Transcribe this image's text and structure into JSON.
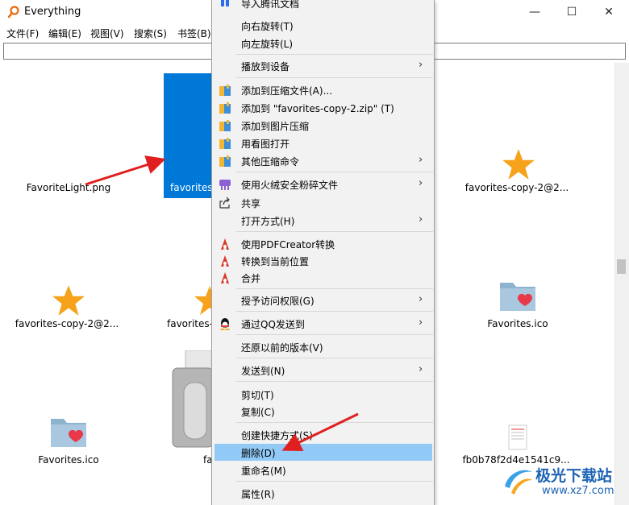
{
  "window": {
    "title": "Everything",
    "minimize": "—",
    "maximize": "☐",
    "close": "✕"
  },
  "menubar": [
    "文件(F)",
    "编辑(E)",
    "视图(V)",
    "搜索(S)",
    "书签(B)"
  ],
  "search": {
    "value": ""
  },
  "files": [
    {
      "label": "FavoriteLight.png",
      "icon": "file-icon"
    },
    {
      "label": "favorites",
      "icon": "selected-file",
      "selected": true
    },
    {
      "label": "favorites-copy-2@2...",
      "icon": "star-icon"
    },
    {
      "label": "favorites-copy-2@2...",
      "icon": "star-icon"
    },
    {
      "label": "favorites-",
      "icon": "star-icon"
    },
    {
      "label": "Favorites.ico",
      "icon": "folder-heart-icon"
    },
    {
      "label": "Favorites.ico",
      "icon": "folder-heart-icon"
    },
    {
      "label": "fa",
      "icon": "scanner-icon"
    },
    {
      "label": "fb0b78f2d4e1541c9...",
      "icon": "document-icon"
    }
  ],
  "context_menu": {
    "items": [
      {
        "label": "导入腾讯文档",
        "icon": "tencent-docs-icon",
        "submenu": false
      },
      {
        "label": "向右旋转(T)",
        "icon": "",
        "submenu": false
      },
      {
        "label": "向左旋转(L)",
        "icon": "",
        "submenu": false
      },
      {
        "label": "播放到设备",
        "icon": "",
        "submenu": true
      },
      {
        "label": "添加到压缩文件(A)...",
        "icon": "archive-icon",
        "submenu": false
      },
      {
        "label": "添加到 \"favorites-copy-2.zip\" (T)",
        "icon": "archive-icon",
        "submenu": false
      },
      {
        "label": "添加到图片压缩",
        "icon": "archive-icon",
        "submenu": false
      },
      {
        "label": "用看图打开",
        "icon": "archive-icon",
        "submenu": false
      },
      {
        "label": "其他压缩命令",
        "icon": "archive-icon",
        "submenu": true
      },
      {
        "label": "使用火绒安全粉碎文件",
        "icon": "shredder-icon",
        "submenu": true
      },
      {
        "label": "共享",
        "icon": "share-icon",
        "submenu": false
      },
      {
        "label": "打开方式(H)",
        "icon": "",
        "submenu": true
      },
      {
        "label": "使用PDFCreator转换",
        "icon": "pdfcreator-icon",
        "submenu": false
      },
      {
        "label": "转换到当前位置",
        "icon": "pdfcreator-icon",
        "submenu": false
      },
      {
        "label": "合并",
        "icon": "pdfcreator-icon",
        "submenu": false
      },
      {
        "label": "授予访问权限(G)",
        "icon": "",
        "submenu": true
      },
      {
        "label": "通过QQ发送到",
        "icon": "qq-icon",
        "submenu": true
      },
      {
        "label": "还原以前的版本(V)",
        "icon": "",
        "submenu": false
      },
      {
        "label": "发送到(N)",
        "icon": "",
        "submenu": true
      },
      {
        "label": "剪切(T)",
        "icon": "",
        "submenu": false
      },
      {
        "label": "复制(C)",
        "icon": "",
        "submenu": false
      },
      {
        "label": "创建快捷方式(S)",
        "icon": "",
        "submenu": false
      },
      {
        "label": "删除(D)",
        "icon": "",
        "submenu": false,
        "highlighted": true
      },
      {
        "label": "重命名(M)",
        "icon": "",
        "submenu": false
      },
      {
        "label": "属性(R)",
        "icon": "",
        "submenu": false
      }
    ],
    "submenu_arrow": "›"
  },
  "watermark": {
    "text": "极光下载站",
    "url": "www.xz7.com"
  },
  "colors": {
    "selection": "#0078d7",
    "menu_highlight": "#91c9f7",
    "annotation_arrow": "#e02020",
    "star": "#f7a21b"
  }
}
